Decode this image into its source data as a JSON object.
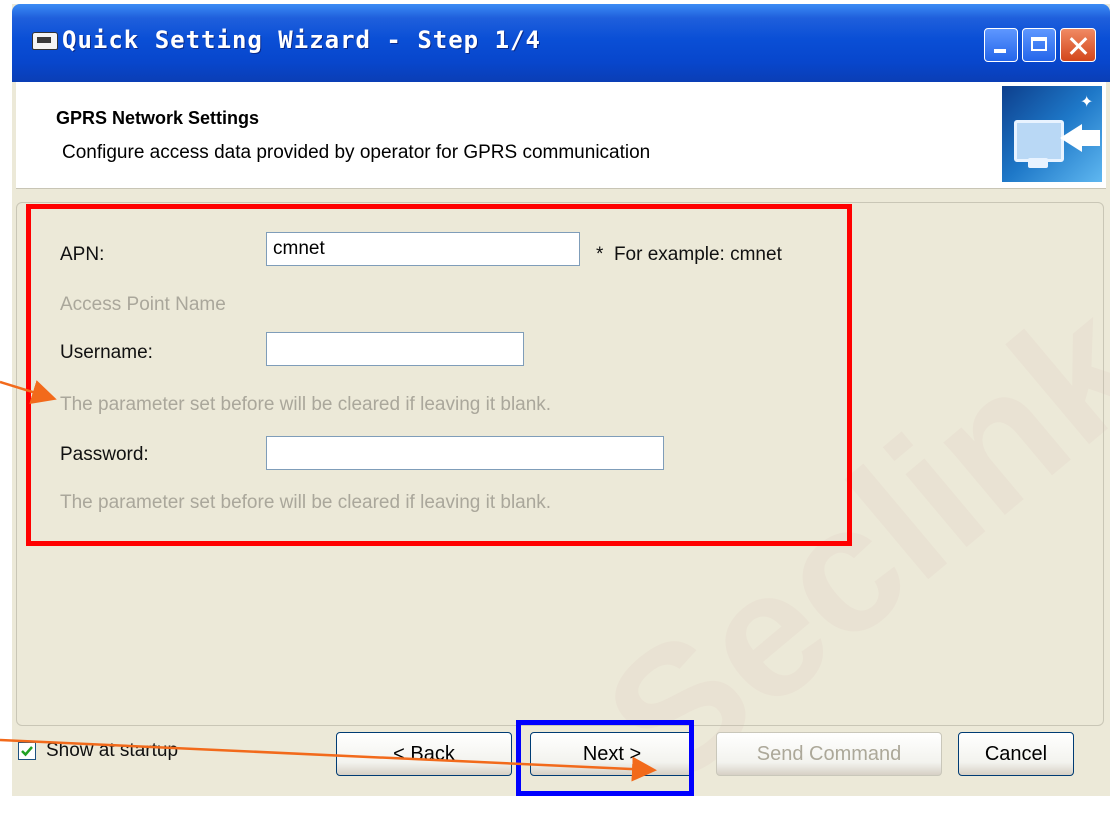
{
  "window": {
    "title": "Quick Setting Wizard - Step 1/4"
  },
  "header": {
    "title": "GPRS Network Settings",
    "subtitle": "Configure access data provided by operator for GPRS communication",
    "icon": "monitor-arrow-icon"
  },
  "form": {
    "apn": {
      "label": "APN:",
      "value": "cmnet",
      "example": "*  For example: cmnet",
      "hint": "Access Point Name"
    },
    "username": {
      "label": "Username:",
      "value": "",
      "hint": "The parameter set before will be cleared if leaving it blank."
    },
    "password": {
      "label": "Password:",
      "value": "",
      "hint": "The parameter set before will be cleared if leaving it blank."
    }
  },
  "footer": {
    "show_at_startup": "Show at startup",
    "show_at_startup_checked": true,
    "back_label": "< Back",
    "next_label": "Next >",
    "send_label": "Send Command",
    "cancel_label": "Cancel"
  },
  "watermark": "Seclink",
  "colors": {
    "highlight_form": "#ff0000",
    "highlight_next": "#0000ff",
    "annotation_arrow": "#f26a1b"
  }
}
